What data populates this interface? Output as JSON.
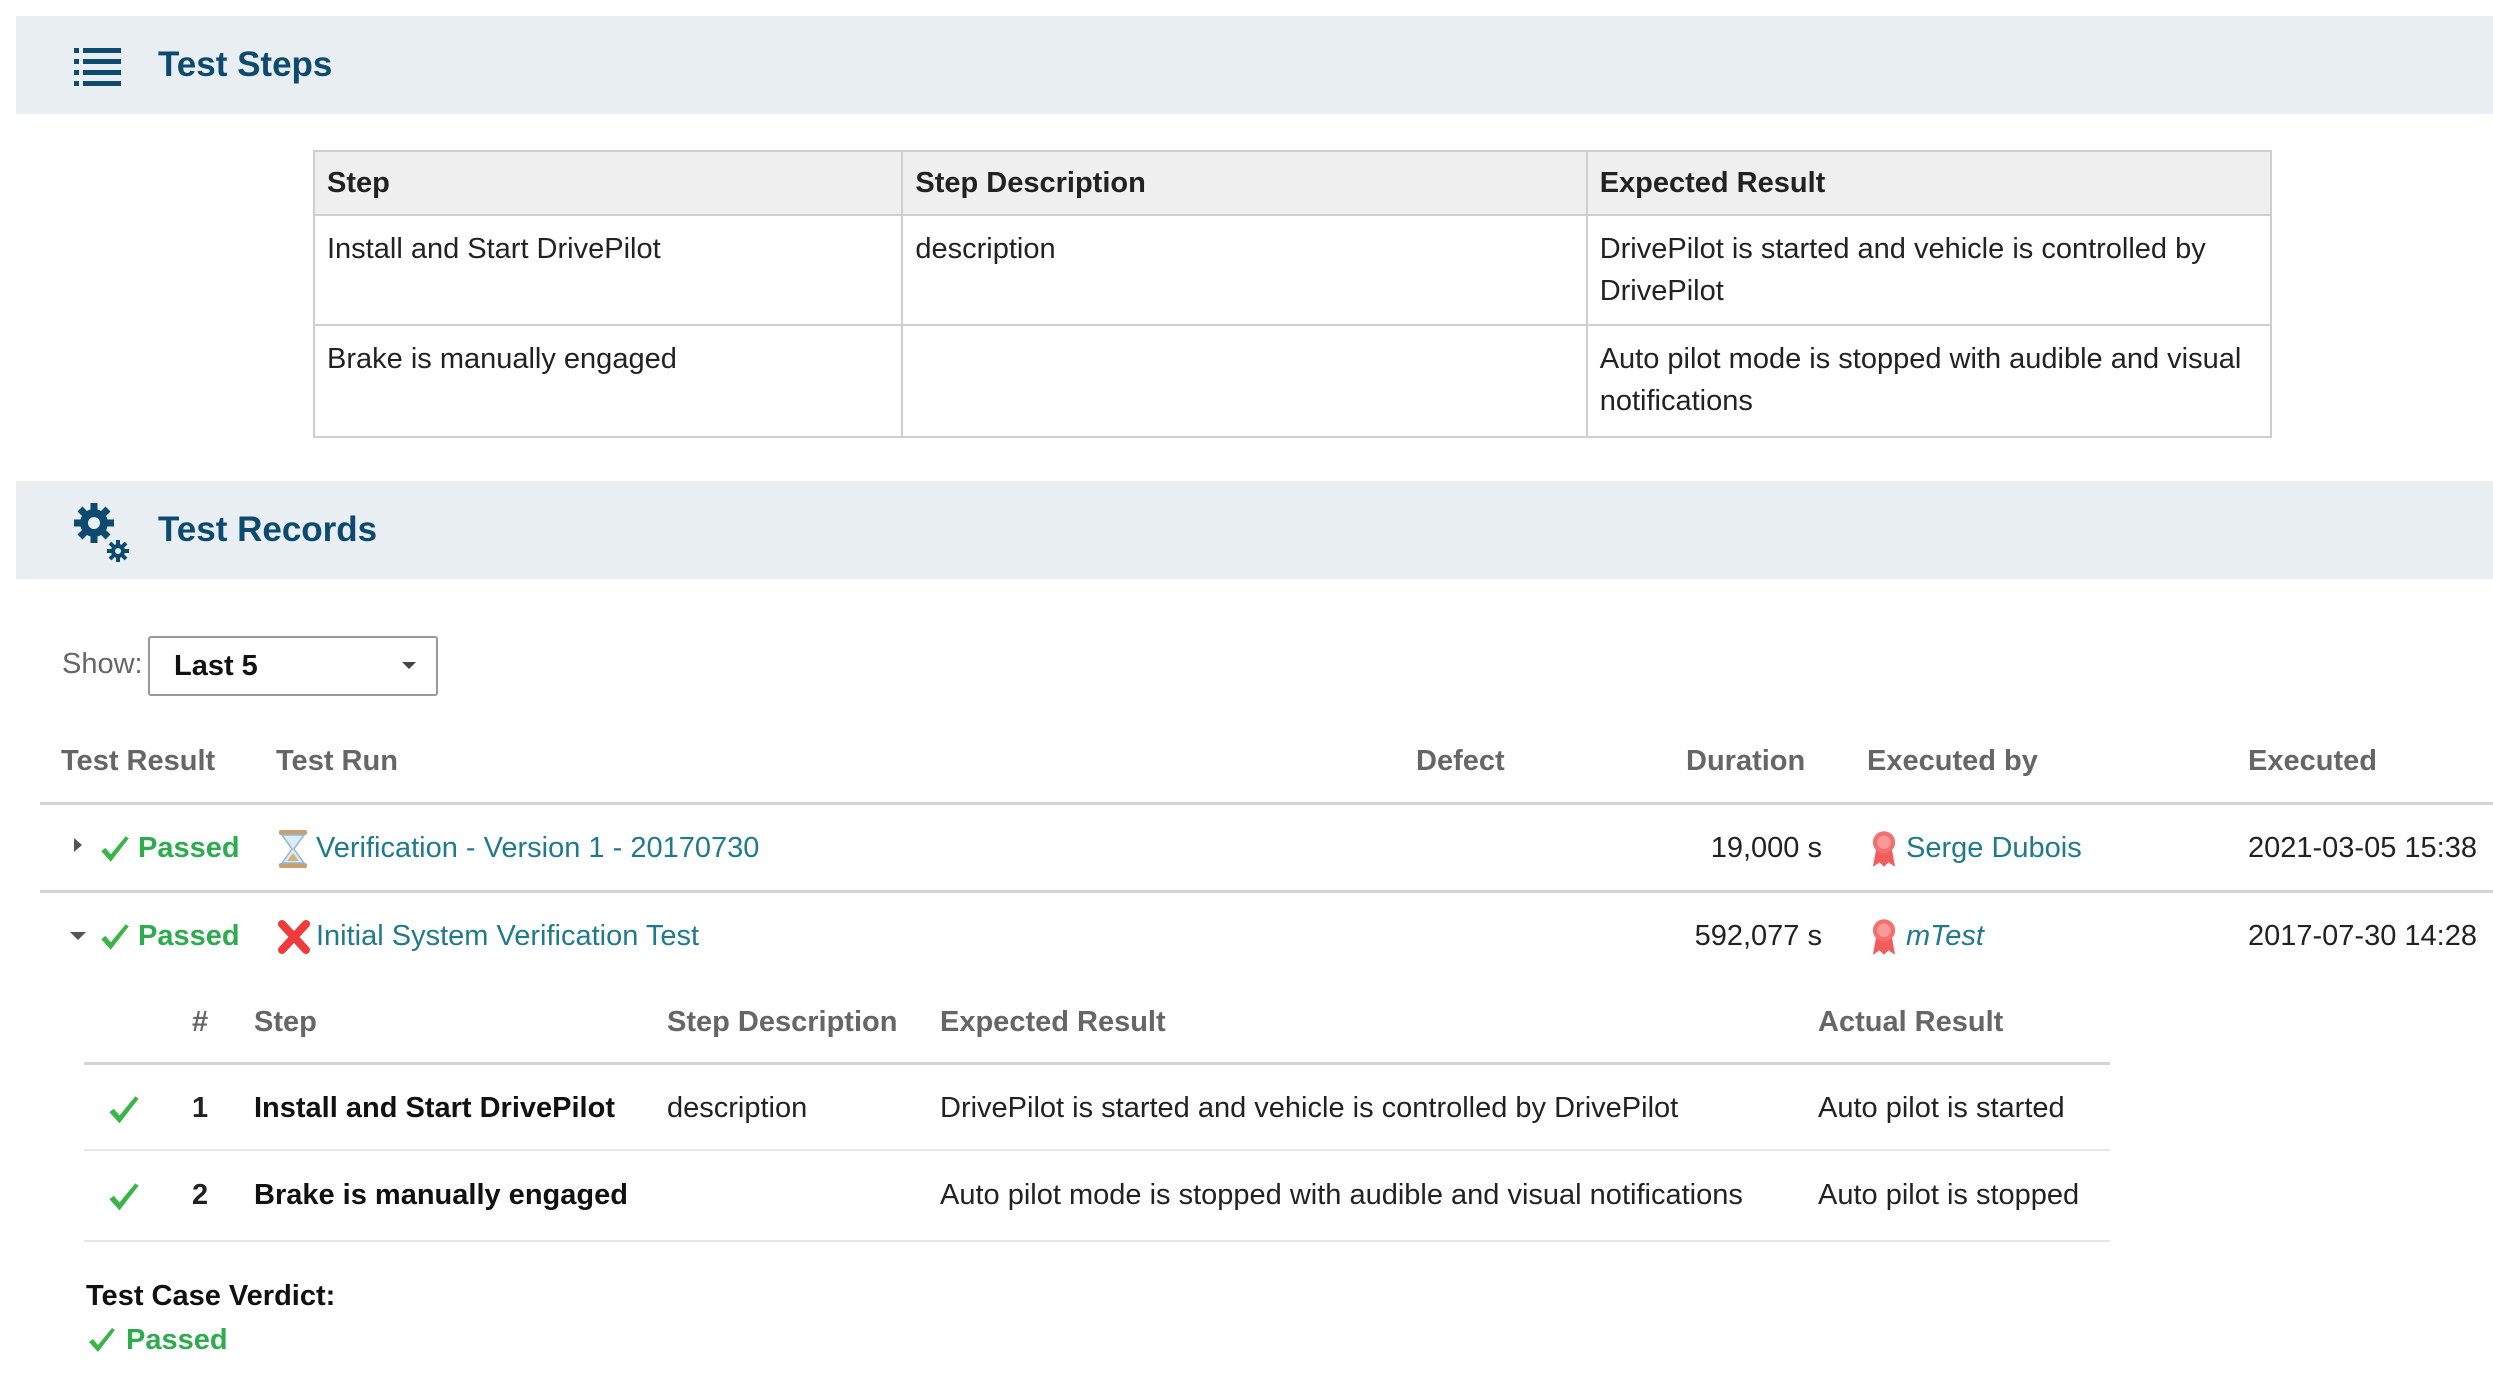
{
  "test_steps": {
    "title": "Test Steps",
    "icon": "list-icon",
    "columns": [
      "Step",
      "Step Description",
      "Expected Result"
    ],
    "rows": [
      {
        "step": "Install and Start DrivePilot",
        "description": "description",
        "expected": "DrivePilot is started and vehicle is controlled by DrivePilot"
      },
      {
        "step": "Brake is manually engaged",
        "description": "",
        "expected": "Auto pilot mode is stopped with audible and visual notifications"
      }
    ]
  },
  "test_records": {
    "title": "Test Records",
    "icon": "gears-icon",
    "show_label": "Show:",
    "show_value": "Last 5",
    "columns": {
      "result": "Test Result",
      "run": "Test Run",
      "defect": "Defect",
      "duration": "Duration",
      "executed_by": "Executed by",
      "executed": "Executed"
    },
    "records": [
      {
        "expanded": false,
        "result": "Passed",
        "run_icon": "hourglass-icon",
        "run": "Verification - Version 1 - 20170730",
        "defect": "",
        "duration": "19,000 s",
        "executed_by": "Serge Dubois",
        "executed": "2021-03-05 15:38"
      },
      {
        "expanded": true,
        "result": "Passed",
        "run_icon": "red-x-icon",
        "run": "Initial System Verification Test",
        "defect": "",
        "duration": "592,077 s",
        "executed_by": "mTest",
        "executed": "2017-07-30 14:28"
      }
    ],
    "detail": {
      "columns": {
        "num": "#",
        "step": "Step",
        "description": "Step Description",
        "expected": "Expected Result",
        "actual": "Actual Result"
      },
      "rows": [
        {
          "num": "1",
          "step": "Install and Start DrivePilot",
          "description": "description",
          "expected": "DrivePilot is started and vehicle is controlled by DrivePilot",
          "actual": "Auto pilot is started"
        },
        {
          "num": "2",
          "step": "Brake is manually engaged",
          "description": "",
          "expected": "Auto pilot mode is stopped with audible and visual notifications",
          "actual": "Auto pilot is stopped"
        }
      ],
      "verdict_label": "Test Case Verdict:",
      "verdict": "Passed"
    }
  },
  "colors": {
    "header_band": "#e9eef3",
    "title": "#0c4a6e",
    "link": "#1f7a8c",
    "passed": "#2eab4f",
    "failed": "#e53935"
  }
}
